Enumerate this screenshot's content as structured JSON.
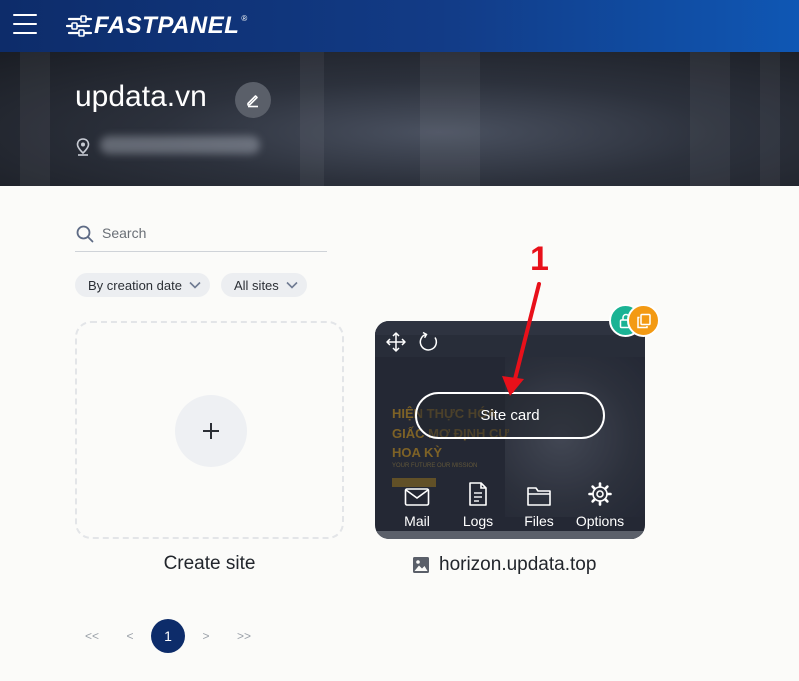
{
  "header": {
    "menu_icon": "hamburger-icon",
    "brand": "FASTPANEL",
    "brand_mark": "®"
  },
  "hero": {
    "title": "updata.vn",
    "edit_icon": "pencil-icon",
    "location_icon": "location-pin-icon"
  },
  "search": {
    "placeholder": "Search",
    "value": ""
  },
  "filters": {
    "sort_label": "By creation date",
    "scope_label": "All sites"
  },
  "create": {
    "label": "Create site",
    "icon": "plus-icon"
  },
  "site": {
    "name": "horizon.updata.top",
    "card_button": "Site card",
    "actions": [
      {
        "label": "Mail",
        "icon": "mail-icon"
      },
      {
        "label": "Logs",
        "icon": "logs-icon"
      },
      {
        "label": "Files",
        "icon": "folder-icon"
      },
      {
        "label": "Options",
        "icon": "gear-icon"
      }
    ],
    "thumbnail": {
      "line1": "HIỆN THỰC HÓA",
      "line2": "GIẤC MƠ ĐỊNH CƯ",
      "line3": "HOA KỲ",
      "tagline": "YOUR FUTURE OUR MISSION"
    }
  },
  "annotation": {
    "number": "1",
    "color": "#e8101a"
  },
  "pagination": {
    "first": "<<",
    "prev": "<",
    "current": "1",
    "next": ">",
    "last": ">>"
  },
  "colors": {
    "header_dark": "#0d2c6a",
    "header_light": "#0f57b4",
    "badge_teal": "#1ab394",
    "badge_orange": "#f39a14",
    "page_active": "#0d2c6a"
  }
}
